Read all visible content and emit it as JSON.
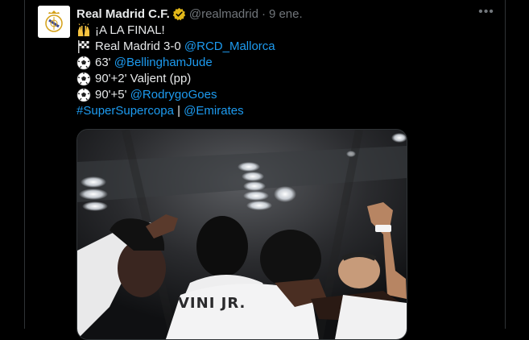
{
  "tweet": {
    "display_name": "Real Madrid C.F.",
    "handle": "@realmadrid",
    "separator": "·",
    "date": "9 ene.",
    "more_label": "•••",
    "lines": {
      "l1": {
        "text": "¡A LA FINAL!"
      },
      "l2": {
        "prefix": "Real Madrid 3-0 ",
        "mention": "@RCD_Mallorca"
      },
      "l3": {
        "prefix": "63' ",
        "mention": "@BellinghamJude"
      },
      "l4": {
        "prefix": "90'+2' Valjent (pp)"
      },
      "l5": {
        "prefix": "90'+5' ",
        "mention": "@RodrygoGoes"
      },
      "l6": {
        "hashtag": "#SuperSupercopa",
        "sep": " | ",
        "mention": "@Emirates"
      }
    },
    "media": {
      "jersey_text": "VINI JR."
    }
  },
  "colors": {
    "background": "#000000",
    "text": "#e7e9ea",
    "secondary": "#71767b",
    "link": "#1d9bf0",
    "verified": "#e2b719",
    "border": "#2f3336"
  },
  "icons": [
    "verified-badge-icon",
    "raised-hands-icon",
    "chequered-flag-icon",
    "soccer-ball-icon",
    "more-icon"
  ]
}
